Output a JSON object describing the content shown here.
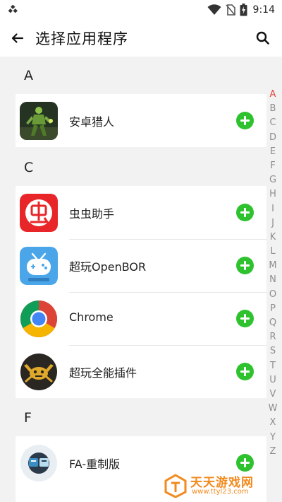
{
  "status_bar": {
    "time": "9:14"
  },
  "app_bar": {
    "title": "选择应用程序"
  },
  "sections": [
    {
      "letter": "A",
      "apps": [
        {
          "name": "安卓猎人",
          "icon": "mecha-robot-icon"
        }
      ]
    },
    {
      "letter": "C",
      "apps": [
        {
          "name": "虫虫助手",
          "icon": "chongchong-icon"
        },
        {
          "name": "超玩OpenBOR",
          "icon": "openbor-gamepad-icon"
        },
        {
          "name": "Chrome",
          "icon": "chrome-icon"
        },
        {
          "name": "超玩全能插件",
          "icon": "gold-crab-icon"
        }
      ]
    },
    {
      "letter": "F",
      "apps": [
        {
          "name": "FA-重制版",
          "icon": "fa-app-icon"
        }
      ]
    }
  ],
  "index_letters": [
    "A",
    "B",
    "C",
    "D",
    "E",
    "F",
    "G",
    "H",
    "I",
    "J",
    "K",
    "L",
    "M",
    "N",
    "O",
    "P",
    "Q",
    "R",
    "S",
    "T",
    "U",
    "V",
    "W",
    "X",
    "Y",
    "Z"
  ],
  "active_index": "A",
  "watermark": {
    "title": "天天游戏网",
    "url": "www.ttyl23.com"
  },
  "colors": {
    "accent_green": "#2ec22e",
    "index_active": "#e0463a",
    "background": "#f2f2f2",
    "watermark": "#f28a1e"
  }
}
